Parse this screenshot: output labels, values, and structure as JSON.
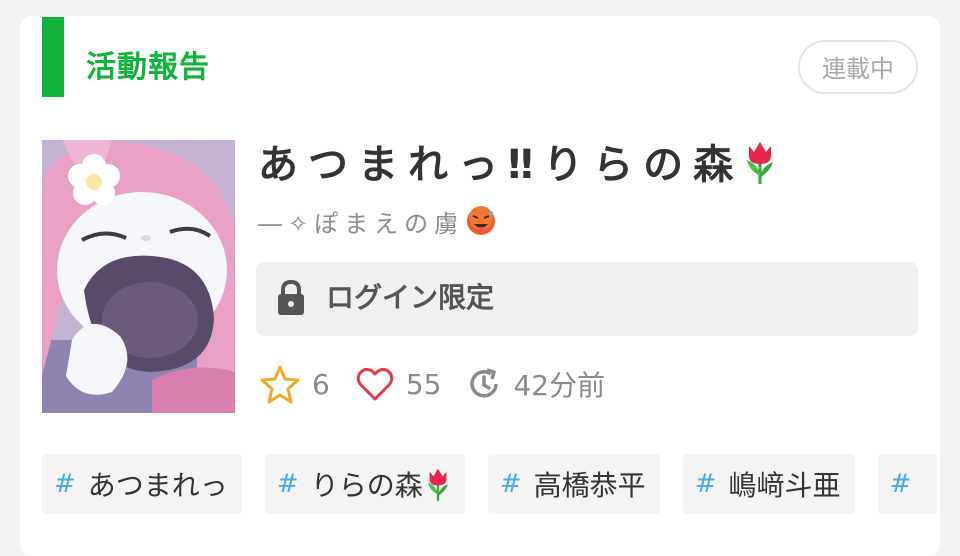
{
  "section": {
    "title": "活動報告",
    "status": "連載中"
  },
  "work": {
    "title": "あつまれっ‼りらの森",
    "title_emoji": "tulip-emoji",
    "author": "―✧ぽまえの虜",
    "author_emoji": "hot-face-emoji",
    "restricted_label": "ログイン限定",
    "stars": "6",
    "likes": "55",
    "updated": "42分前"
  },
  "tags": [
    {
      "hash": "#",
      "label": "あつまれっ"
    },
    {
      "hash": "#",
      "label": "りらの森"
    },
    {
      "hash": "#",
      "label": "高橋恭平"
    },
    {
      "hash": "#",
      "label": "嶋﨑斗亜"
    },
    {
      "hash": "#",
      "label": ""
    }
  ],
  "colors": {
    "accent_green": "#12b339",
    "tag_hash_blue": "#4aa8e8",
    "star_orange": "#f0a92b",
    "heart_red": "#e5394a"
  }
}
